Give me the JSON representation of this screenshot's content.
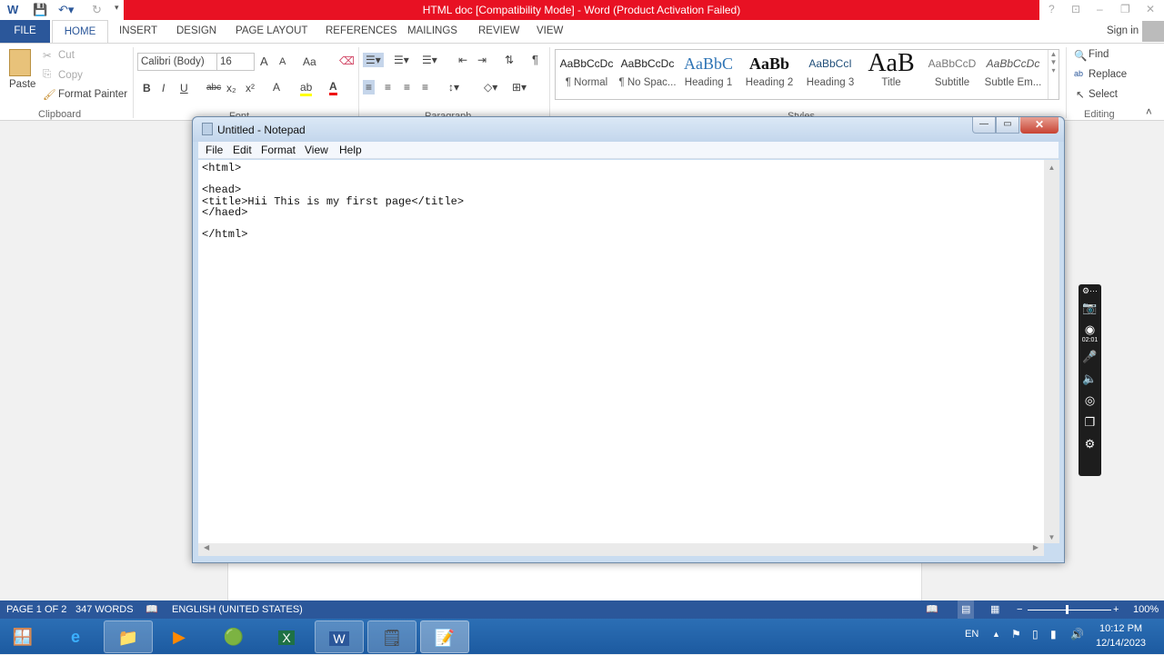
{
  "word": {
    "title": "HTML doc [Compatibility Mode] - Word (Product Activation Failed)",
    "accent": "#2b579a",
    "title_bar_color": "#e81123",
    "tabs": [
      "FILE",
      "HOME",
      "INSERT",
      "DESIGN",
      "PAGE LAYOUT",
      "REFERENCES",
      "MAILINGS",
      "REVIEW",
      "VIEW"
    ],
    "active_tab": "HOME",
    "sign_in": "Sign in",
    "clipboard": {
      "paste": "Paste",
      "cut": "Cut",
      "copy": "Copy",
      "format_painter": "Format Painter",
      "label": "Clipboard"
    },
    "font": {
      "name": "Calibri (Body)",
      "size": "16",
      "label": "Font",
      "grow": "A",
      "shrink": "A",
      "case": "Aa",
      "bold": "B",
      "italic": "I",
      "underline": "U",
      "strike": "abc",
      "sub": "x₂",
      "sup": "x²"
    },
    "paragraph": {
      "label": "Paragraph",
      "pilcrow": "¶"
    },
    "styles": {
      "label": "Styles",
      "items": [
        {
          "preview": "AaBbCcDc",
          "name": "¶ Normal"
        },
        {
          "preview": "AaBbCcDc",
          "name": "¶ No Spac..."
        },
        {
          "preview": "AaBbC",
          "name": "Heading 1"
        },
        {
          "preview": "AaBb",
          "name": "Heading 2"
        },
        {
          "preview": "AaBbCcI",
          "name": "Heading 3"
        },
        {
          "preview": "AaB",
          "name": "Title"
        },
        {
          "preview": "AaBbCcD",
          "name": "Subtitle"
        },
        {
          "preview": "AaBbCcDc",
          "name": "Subtle Em..."
        }
      ]
    },
    "editing": {
      "find": "Find",
      "replace": "Replace",
      "select": "Select",
      "label": "Editing"
    },
    "status": {
      "page": "PAGE 1 OF 2",
      "words": "347 WORDS",
      "language": "ENGLISH (UNITED STATES)",
      "zoom": "100%"
    }
  },
  "notepad": {
    "title": "Untitled - Notepad",
    "menu": [
      "File",
      "Edit",
      "Format",
      "View",
      "Help"
    ],
    "content": "<html>\n\n<head>\n<title>Hii This is my first page</title>\n</haed>\n\n</html>"
  },
  "recorder": {
    "timer": "02:01"
  },
  "taskbar": {
    "apps": [
      "start",
      "internet-explorer",
      "file-explorer",
      "media-player",
      "chrome",
      "excel",
      "word",
      "sticky-notes",
      "notepad"
    ],
    "lang": "EN",
    "time": "10:12 PM",
    "date": "12/14/2023"
  }
}
